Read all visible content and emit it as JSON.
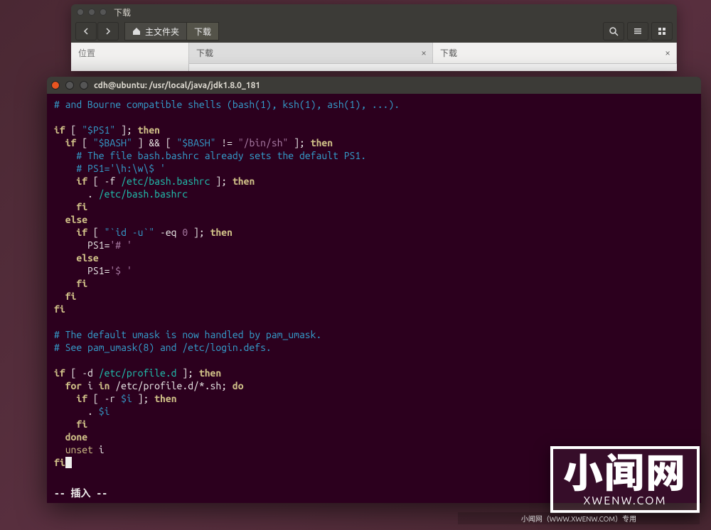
{
  "nautilus": {
    "title": "下载",
    "breadcrumb": {
      "home": "主文件夹",
      "downloads": "下载"
    },
    "sidebar_header": "位置",
    "tabs": [
      {
        "label": "下载"
      },
      {
        "label": "下载"
      }
    ]
  },
  "terminal": {
    "title": "cdh@ubuntu: /usr/local/java/jdk1.8.0_181",
    "status": "-- 插入 --",
    "code": {
      "l1_a": "# and Bourne compatible shells (bash(1), ksh(1), ash(1), ...).",
      "l3_if": "if",
      "l3_a": " [ ",
      "l3_b": "\"$PS1\"",
      "l3_c": " ]; ",
      "l3_then": "then",
      "l4_if": "if",
      "l4_a": " [ ",
      "l4_b": "\"$BASH\"",
      "l4_c": " ] ",
      "l4_amp": "&&",
      "l4_d": " [ ",
      "l4_e": "\"$BASH\"",
      "l4_f": " != ",
      "l4_g": "\"/bin/sh\"",
      "l4_h": " ]; ",
      "l4_then": "then",
      "l5": "# The file bash.bashrc already sets the default PS1.",
      "l6": "# PS1='\\h:\\w\\$ '",
      "l7_if": "if",
      "l7_a": " [ -f ",
      "l7_b": "/etc/bash.bashrc",
      "l7_c": " ]; ",
      "l7_then": "then",
      "l8_a": ". ",
      "l8_b": "/etc/bash.bashrc",
      "l9": "fi",
      "l10": "else",
      "l11_if": "if",
      "l11_a": " [ ",
      "l11_b": "\"`id -u`\"",
      "l11_c": " -eq ",
      "l11_d": "0",
      "l11_e": " ]; ",
      "l11_then": "then",
      "l12_a": "PS1=",
      "l12_b": "'# '",
      "l13": "else",
      "l14_a": "PS1=",
      "l14_b": "'$ '",
      "l15": "fi",
      "l16": "fi",
      "l17": "fi",
      "l19": "# The default umask is now handled by pam_umask.",
      "l20": "# See pam_umask(8) and /etc/login.defs.",
      "l22_if": "if",
      "l22_a": " [ -d ",
      "l22_b": "/etc/profile.d",
      "l22_c": " ]; ",
      "l22_then": "then",
      "l23_for": "for",
      "l23_a": " i ",
      "l23_in": "in",
      "l23_b": " /etc/profile.d/*.sh; ",
      "l23_do": "do",
      "l24_if": "if",
      "l24_a": " [ -r ",
      "l24_b": "$i",
      "l24_c": " ]; ",
      "l24_then": "then",
      "l25_a": ". ",
      "l25_b": "$i",
      "l26": "fi",
      "l27": "done",
      "l28_a": "unset",
      "l28_b": " i",
      "l29": "fi"
    }
  },
  "watermark": {
    "big": "小闻网",
    "url": "XWENW.COM",
    "footer": "小闻网（WWW.XWENW.COM）专用"
  }
}
